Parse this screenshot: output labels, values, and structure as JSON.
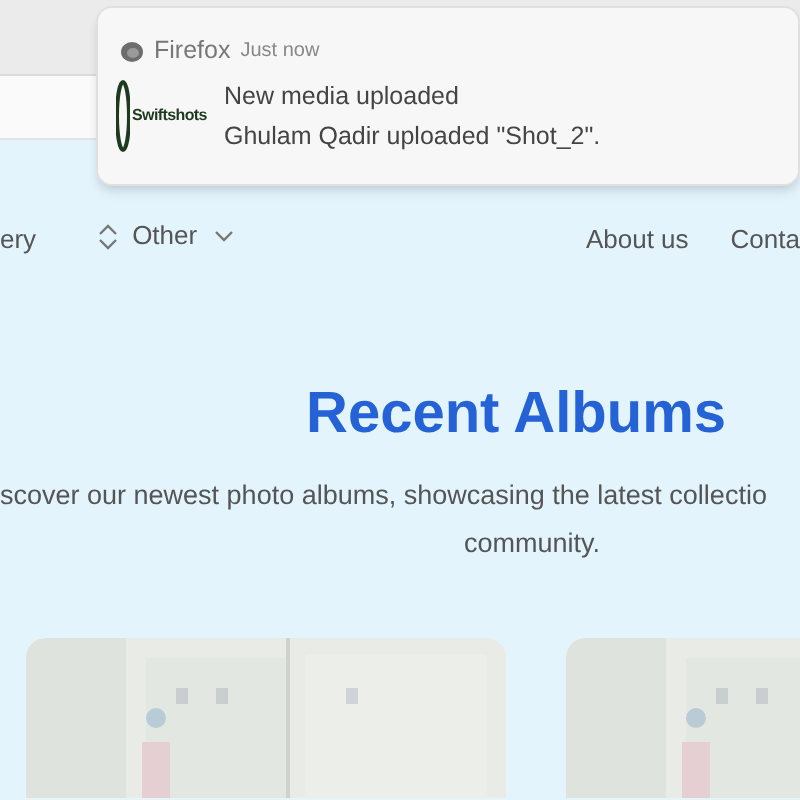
{
  "notification": {
    "app": "Firefox",
    "time": "Just now",
    "logo_text": "Swiftshots",
    "title": "New media uploaded",
    "body": "Ghulam Qadir uploaded \"Shot_2\"."
  },
  "nav": {
    "left": [
      {
        "label": "ery",
        "kind": "link"
      },
      {
        "label": "Other",
        "kind": "dropdown"
      }
    ],
    "right": [
      {
        "label": "About us"
      },
      {
        "label": "Conta"
      }
    ]
  },
  "heading": "Recent Albums",
  "description": [
    "scover our newest photo albums, showcasing the latest collectio",
    "community."
  ]
}
